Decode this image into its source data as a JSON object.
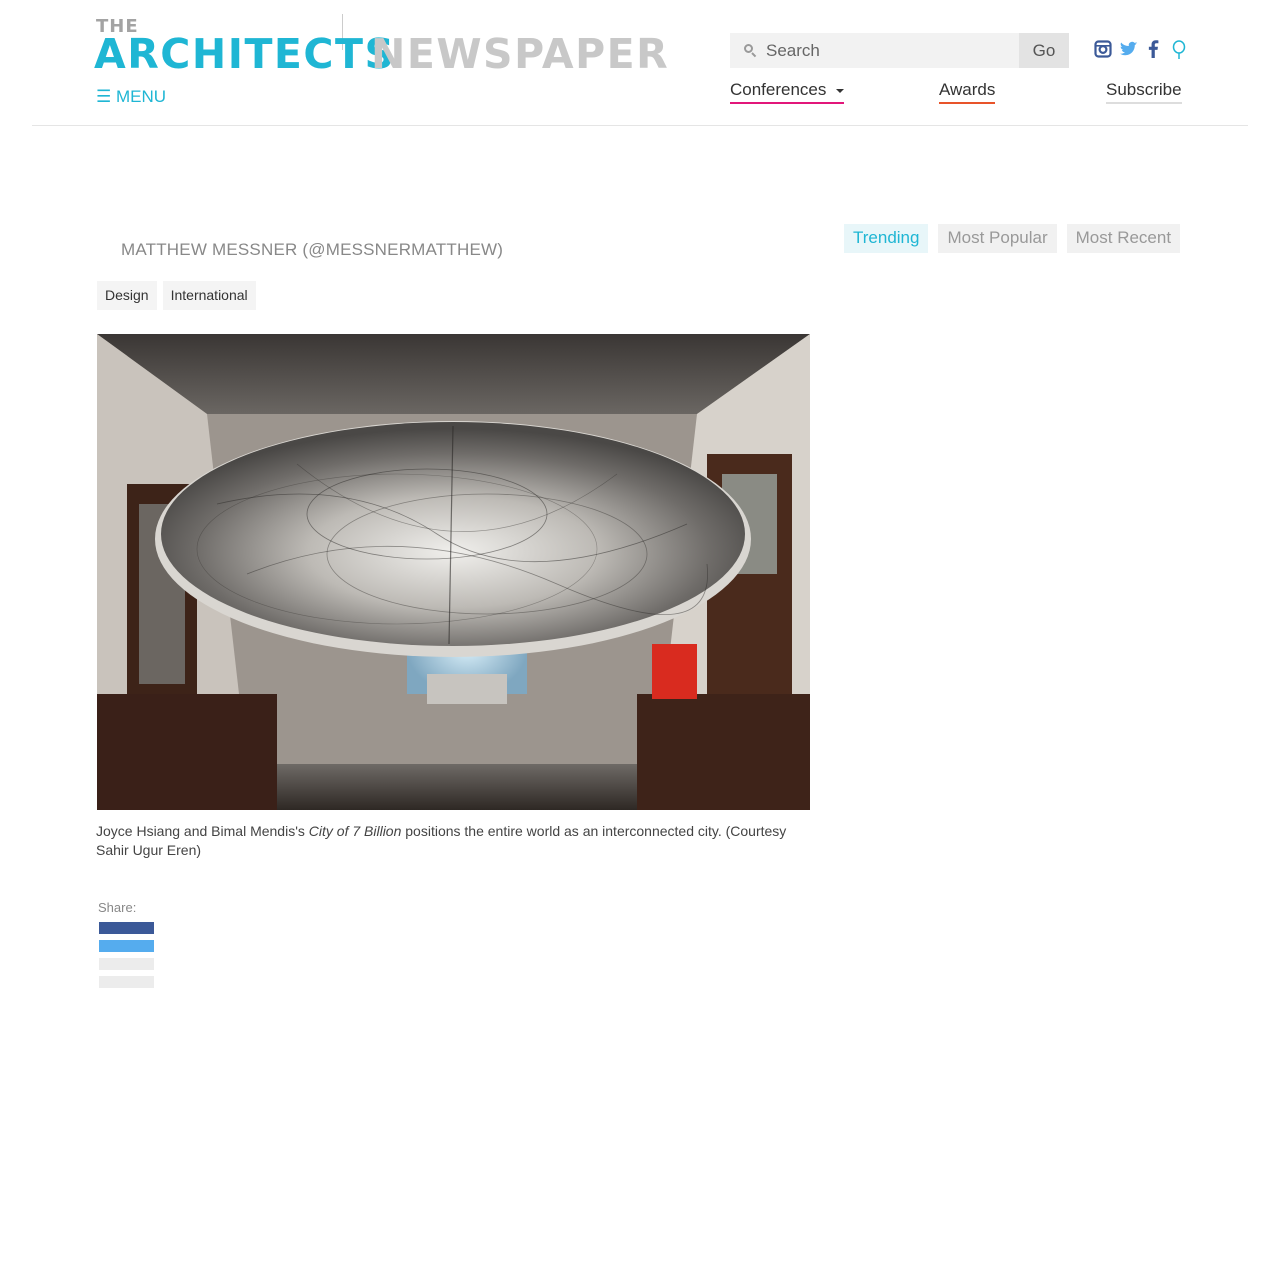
{
  "logo": {
    "the": "THE",
    "architects": "ARCHITECTS",
    "newspaper": "NEWSPAPER"
  },
  "menu": {
    "label": "☰ MENU"
  },
  "search": {
    "placeholder": "Search",
    "go_label": "Go"
  },
  "social": [
    "instagram-icon",
    "twitter-icon",
    "facebook-icon",
    "pin-icon"
  ],
  "nav": {
    "conferences": "Conferences",
    "awards": "Awards",
    "subscribe": "Subscribe"
  },
  "article": {
    "author": "MATTHEW MESSNER (@MESSNERMATTHEW)",
    "tags": [
      "Design",
      "International"
    ],
    "caption_pre": "Joyce Hsiang and Bimal Mendis's ",
    "caption_title": "City of 7 Billion",
    "caption_post": " positions the entire world as an interconnected city. (Courtesy Sahir Ugur Eren)",
    "share_label": "Share:"
  },
  "tabs": [
    "Trending",
    "Most Popular",
    "Most Recent"
  ],
  "colors": {
    "accent": "#1fb6d4",
    "conferences_underline": "#e2167a",
    "awards_underline": "#e8542a",
    "facebook": "#3b5998",
    "twitter": "#55acee"
  }
}
